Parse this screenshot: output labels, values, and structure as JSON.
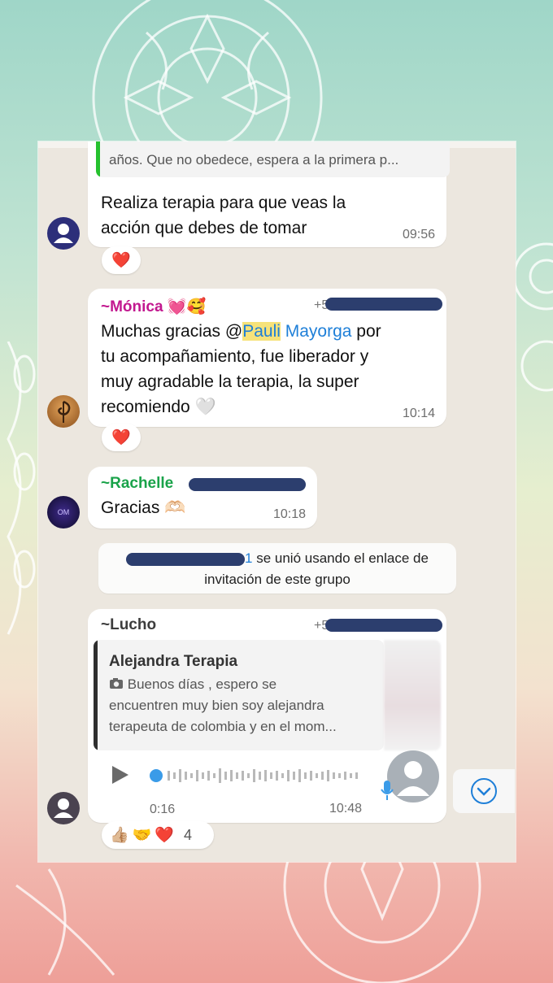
{
  "messages": {
    "m1": {
      "quoted_text": "años. Que no obedece, espera a la primera p...",
      "line1": "Realiza terapia para que veas la",
      "line2": "acción que debes de tomar",
      "time": "09:56",
      "reactions": "❤️"
    },
    "m2": {
      "sender": "~Mónica 💓🥰",
      "phone_prefix": "+5",
      "text_before": "Muchas gracias @",
      "mention_hl": "Pauli",
      "mention_rest": " Mayorga",
      "text_after": " por",
      "line2": "tu acompañamiento, fue liberador y",
      "line3": "muy agradable la terapia, la super",
      "line4": "recomiendo 🤍",
      "time": "10:14",
      "reactions": "❤️"
    },
    "m3": {
      "sender": "~Rachelle",
      "text": "Gracias 🫶🏻",
      "time": "10:18",
      "avatar_text": "OM"
    },
    "system": {
      "phone_suffix": "1",
      "line1": " se unió usando el enlace de",
      "line2": "invitación de este grupo"
    },
    "m4": {
      "sender": "~Lucho",
      "phone_prefix": "+5",
      "fwd_title": "Alejandra Terapia",
      "fwd_line1": "Buenos días , espero se",
      "fwd_line2": "encuentren muy bien  soy alejandra",
      "fwd_line3": "terapeuta de colombia  y en el mom...",
      "duration": "0:16",
      "time": "10:48",
      "reactions": "👍🏼🤝❤️",
      "reaction_count": "4"
    }
  },
  "icons": {
    "play": "play-icon",
    "mic": "mic-icon",
    "camera": "camera-icon",
    "scroll": "chevron-down-icon"
  },
  "colors": {
    "monica": "#c2188f",
    "rachelle": "#1aa34a",
    "quote_bar": "#25c12e",
    "mention": "#1e7fd8",
    "redact": "#2c3e6e"
  }
}
